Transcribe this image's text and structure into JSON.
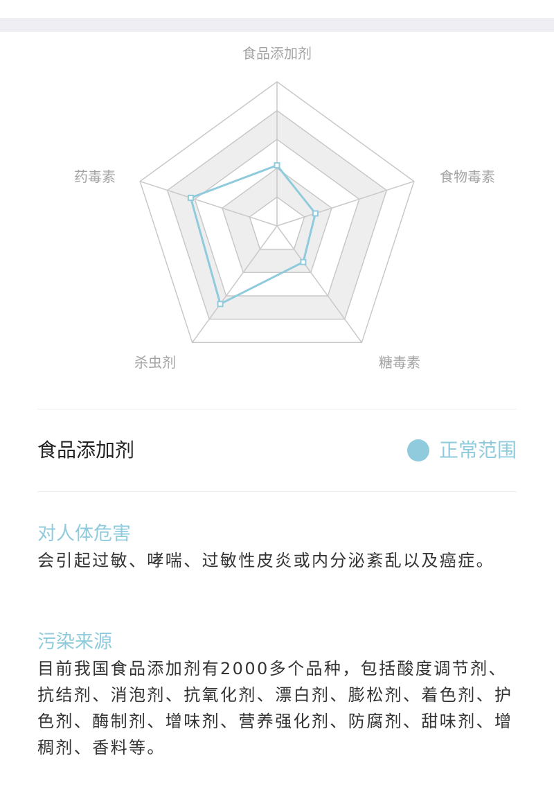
{
  "colors": {
    "accent": "#8fcbdc",
    "grid": "#c8c8c8",
    "band": "#eeeeee",
    "label": "#a3a3a3"
  },
  "chart_data": {
    "type": "radar",
    "axes": [
      "食品添加剂",
      "食物毒素",
      "糖毒素",
      "杀虫剂",
      "药毒素"
    ],
    "max": 5,
    "rings": 5,
    "values": [
      2.1,
      1.4,
      1.55,
      3.35,
      3.15
    ]
  },
  "detail": {
    "title": "食品添加剂",
    "status_label": "正常范围",
    "status_icon": "circle-dot-icon"
  },
  "sections": [
    {
      "heading": "对人体危害",
      "body": "会引起过敏、哮喘、过敏性皮炎或内分泌紊乱以及癌症。"
    },
    {
      "heading": "污染来源",
      "body": "目前我国食品添加剂有2000多个品种，包括酸度调节剂、抗结剂、消泡剂、抗氧化剂、漂白剂、膨松剂、着色剂、护色剂、酶制剂、增味剂、营养强化剂、防腐剂、甜味剂、增稠剂、香料等。"
    }
  ]
}
